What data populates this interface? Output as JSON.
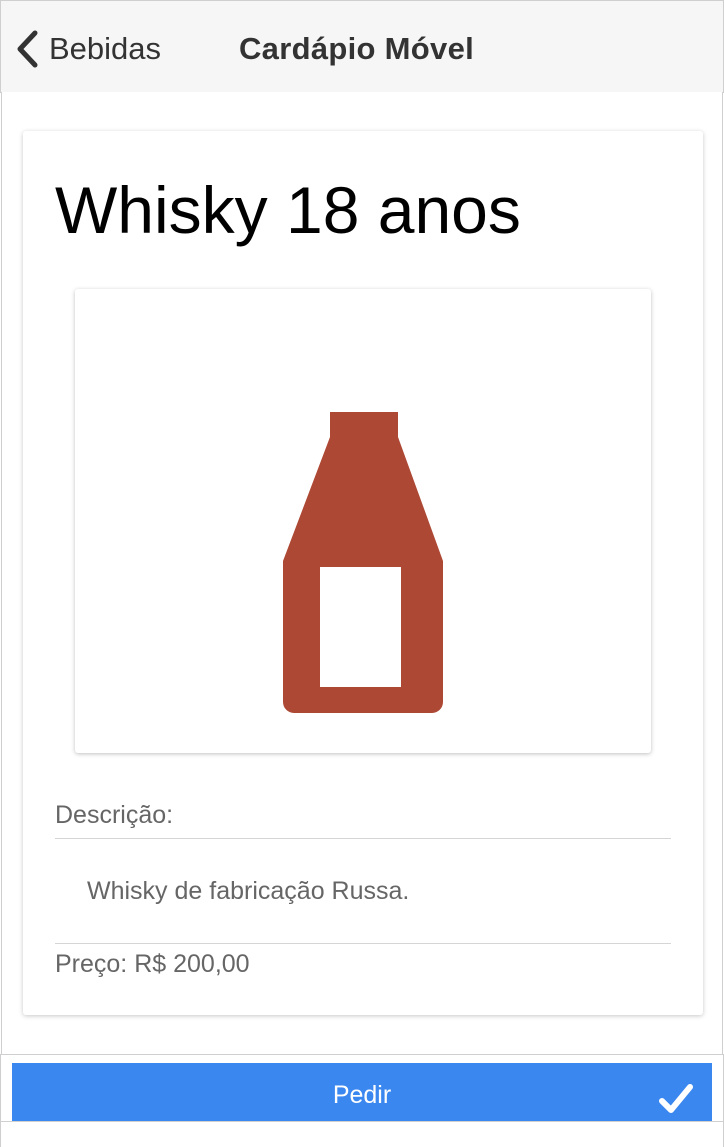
{
  "navbar": {
    "back_label": "Bebidas",
    "title": "Cardápio Móvel"
  },
  "product": {
    "name": "Whisky 18 anos",
    "image_icon": "bottle-icon",
    "image_color": "#ad4834",
    "description_label": "Descrição:",
    "description": "Whisky de fabricação Russa.",
    "price_text": "Preço: R$ 200,00"
  },
  "footer": {
    "order_label": "Pedir",
    "order_icon": "check-icon",
    "order_color": "#3a87f0"
  }
}
